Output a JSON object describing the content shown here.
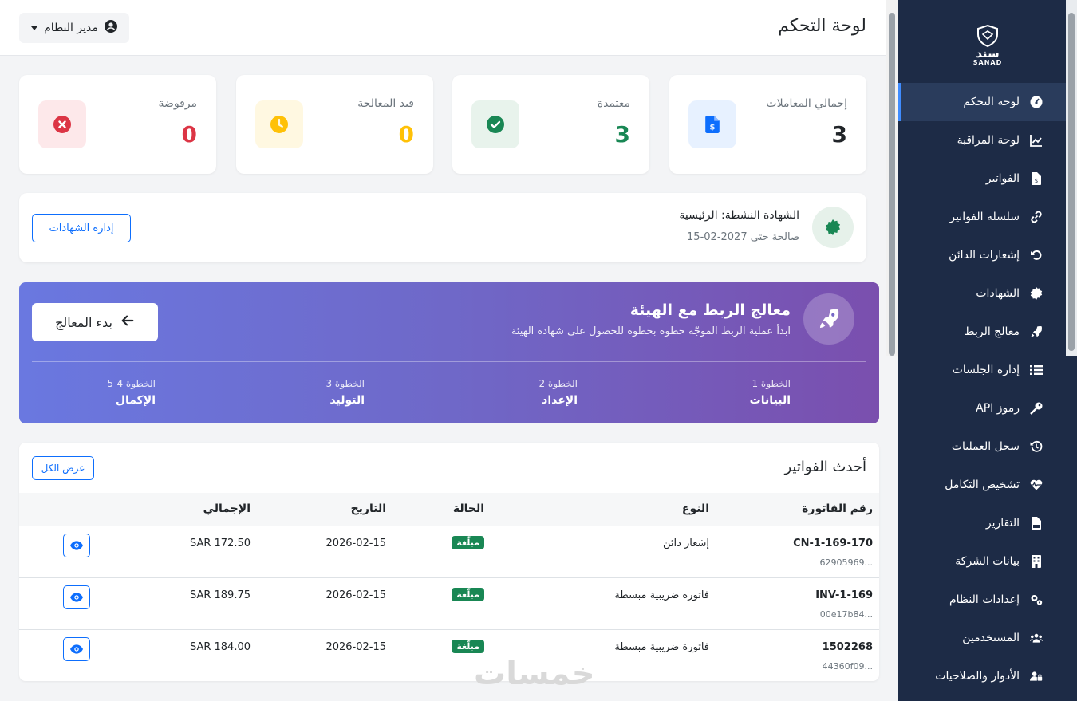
{
  "header": {
    "title": "لوحة التحكم",
    "user_label": "مدير النظام"
  },
  "brand": {
    "name": "سند",
    "latin": "SANAD"
  },
  "sidebar": {
    "items": [
      {
        "label": "لوحة التحكم",
        "icon": "gauge-icon",
        "active": true
      },
      {
        "label": "لوحة المراقبة",
        "icon": "chart-line-icon"
      },
      {
        "label": "الفواتير",
        "icon": "file-invoice-icon"
      },
      {
        "label": "سلسلة الفواتير",
        "icon": "link-icon"
      },
      {
        "label": "إشعارات الدائن",
        "icon": "undo-icon"
      },
      {
        "label": "الشهادات",
        "icon": "certificate-icon"
      },
      {
        "label": "معالج الربط",
        "icon": "rocket-icon"
      },
      {
        "label": "إدارة الجلسات",
        "icon": "list-icon"
      },
      {
        "label": "رموز API",
        "icon": "key-icon"
      },
      {
        "label": "سجل العمليات",
        "icon": "history-icon"
      },
      {
        "label": "تشخيص التكامل",
        "icon": "heartbeat-icon"
      },
      {
        "label": "التقارير",
        "icon": "csv-file-icon"
      },
      {
        "label": "بيانات الشركة",
        "icon": "building-icon"
      },
      {
        "label": "إعدادات النظام",
        "icon": "gears-icon"
      },
      {
        "label": "المستخدمين",
        "icon": "users-icon"
      },
      {
        "label": "الأدوار والصلاحيات",
        "icon": "user-lock-icon"
      }
    ]
  },
  "stats": [
    {
      "label": "إجمالي المعاملات",
      "value": "3",
      "color": "#212529",
      "bg": "#e7f1ff",
      "icon_color": "#0d6efd",
      "icon": "file-invoice-dollar-icon"
    },
    {
      "label": "معتمدة",
      "value": "3",
      "color": "#198754",
      "bg": "#e8f3ec",
      "icon_color": "#198754",
      "icon": "check-circle-icon"
    },
    {
      "label": "قيد المعالجة",
      "value": "0",
      "color": "#ffc107",
      "bg": "#fff8e1",
      "icon_color": "#ffc107",
      "icon": "clock-icon"
    },
    {
      "label": "مرفوضة",
      "value": "0",
      "color": "#dc3545",
      "bg": "#fde8ea",
      "icon_color": "#dc3545",
      "icon": "times-circle-icon"
    }
  ],
  "certificate": {
    "title": "الشهادة النشطة: الرئيسية",
    "valid_until": "صالحة حتى 2027-02-15",
    "manage_button": "إدارة الشهادات"
  },
  "wizard": {
    "title": "معالج الربط مع الهيئة",
    "subtitle": "ابدأ عملية الربط الموجّه خطوة بخطوة للحصول على شهادة الهيئة",
    "start_button": "بدء المعالج",
    "steps": [
      {
        "label": "الخطوة 1",
        "name": "البيانات"
      },
      {
        "label": "الخطوة 2",
        "name": "الإعداد"
      },
      {
        "label": "الخطوة 3",
        "name": "التوليد"
      },
      {
        "label": "الخطوة 4-5",
        "name": "الإكمال"
      }
    ]
  },
  "invoices": {
    "title": "أحدث الفواتير",
    "view_all": "عرض الكل",
    "columns": [
      "رقم الفاتورة",
      "النوع",
      "الحالة",
      "التاريخ",
      "الإجمالي"
    ],
    "rows": [
      {
        "number": "CN-1-169-170",
        "hash": "...62905969",
        "type": "إشعار دائن",
        "status": "مبلّغة",
        "date": "2026-02-15",
        "total": "SAR 172.50"
      },
      {
        "number": "INV-1-169",
        "hash": "...00e17b84",
        "type": "فاتورة ضريبية مبسطة",
        "status": "مبلّغة",
        "date": "2026-02-15",
        "total": "SAR 189.75"
      },
      {
        "number": "1502268",
        "hash": "...44360f09",
        "type": "فاتورة ضريبية مبسطة",
        "status": "مبلّغة",
        "date": "2026-02-15",
        "total": "SAR 184.00"
      }
    ]
  },
  "watermark": "خمسات"
}
